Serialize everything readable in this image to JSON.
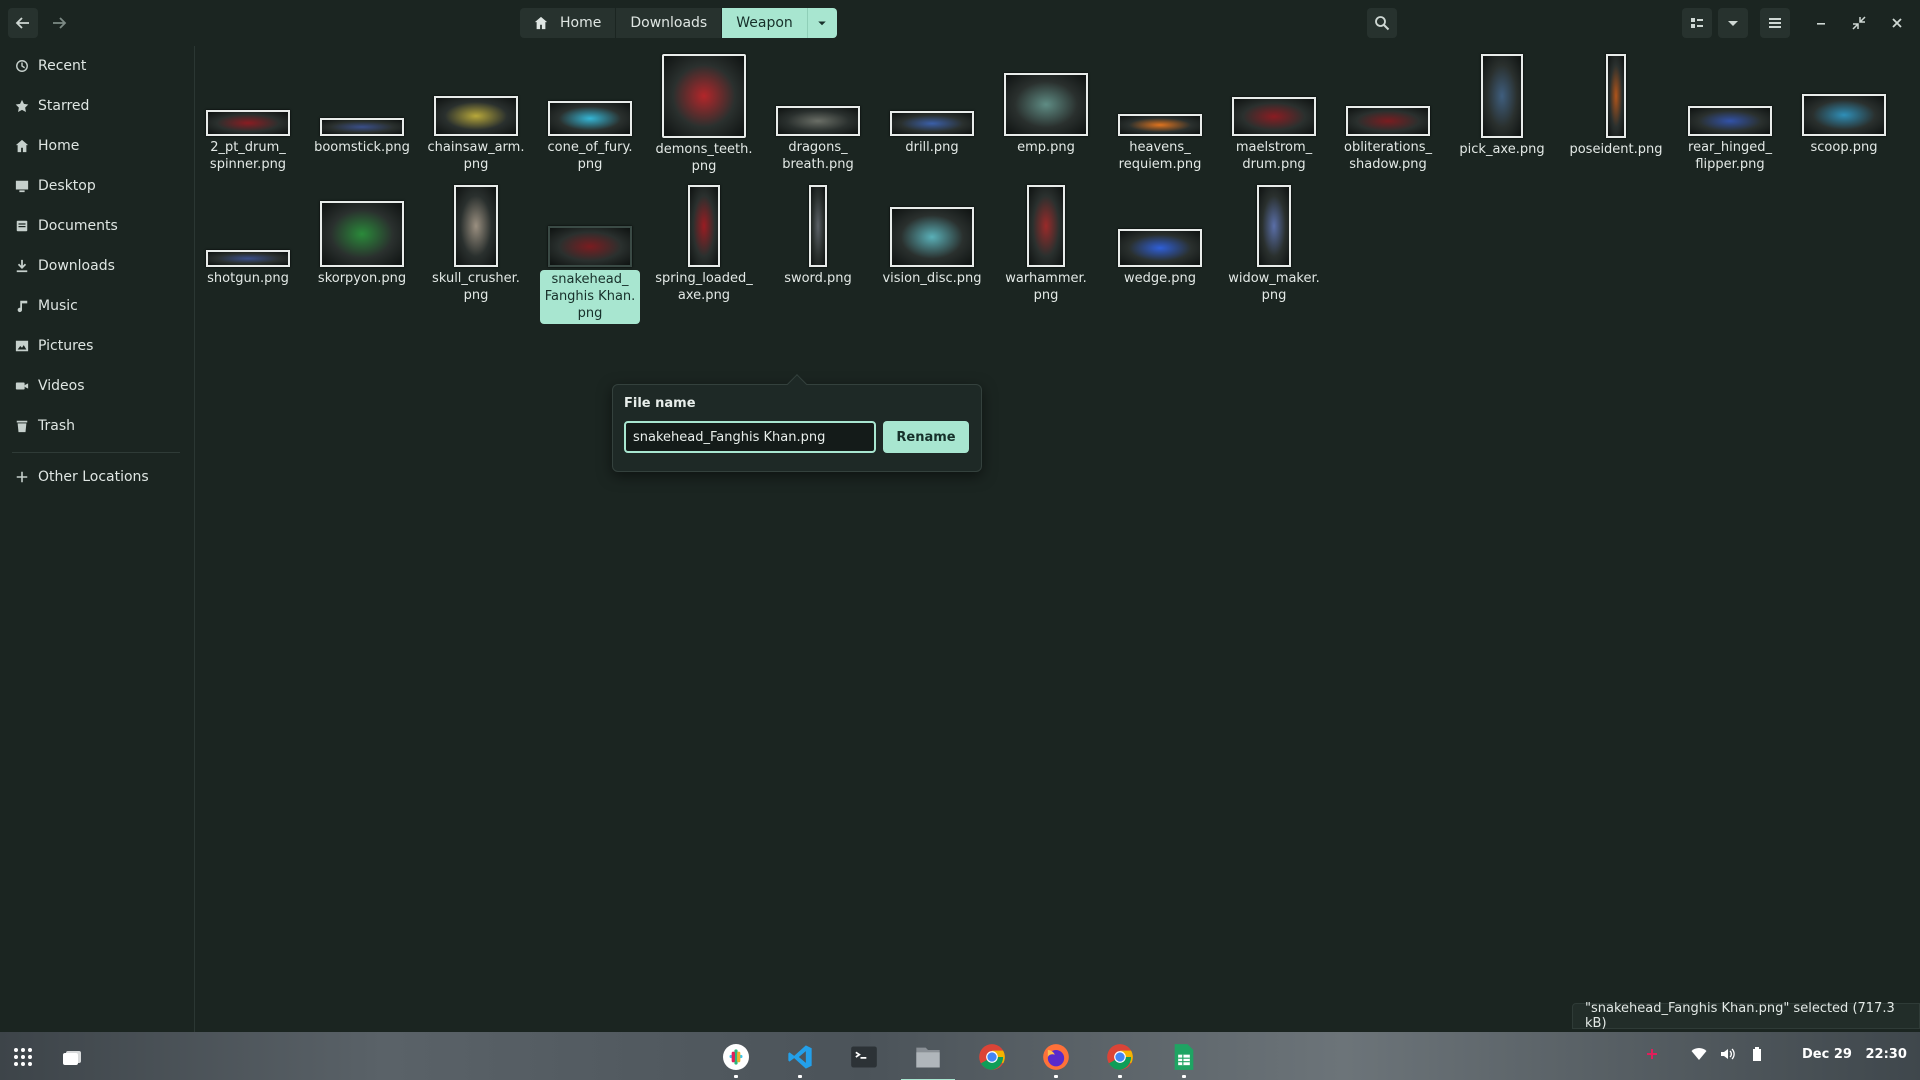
{
  "header": {
    "path": [
      {
        "label": "Home",
        "icon": "home-icon"
      },
      {
        "label": "Downloads"
      },
      {
        "label": "Weapon",
        "active": true
      }
    ]
  },
  "sidebar": {
    "items": [
      {
        "label": "Recent",
        "icon": "clock-icon"
      },
      {
        "label": "Starred",
        "icon": "star-icon"
      },
      {
        "label": "Home",
        "icon": "home-icon"
      },
      {
        "label": "Desktop",
        "icon": "desktop-icon"
      },
      {
        "label": "Documents",
        "icon": "document-icon"
      },
      {
        "label": "Downloads",
        "icon": "download-icon"
      },
      {
        "label": "Music",
        "icon": "music-icon"
      },
      {
        "label": "Pictures",
        "icon": "picture-icon"
      },
      {
        "label": "Videos",
        "icon": "video-icon"
      },
      {
        "label": "Trash",
        "icon": "trash-icon"
      }
    ],
    "other": {
      "label": "Other Locations",
      "icon": "plus-icon"
    }
  },
  "files": [
    {
      "name": "2_pt_drum_ spinner.png",
      "color": "#8a1c22"
    },
    {
      "name": "boomstick.png",
      "color": "#3a4f8a"
    },
    {
      "name": "chainsaw_arm. png",
      "color": "#b8a83a"
    },
    {
      "name": "cone_of_fury. png",
      "color": "#35b6d6"
    },
    {
      "name": "demons_teeth. png",
      "color": "#b3262a"
    },
    {
      "name": "dragons_ breath.png",
      "color": "#6a6e66"
    },
    {
      "name": "drill.png",
      "color": "#3b5fa8"
    },
    {
      "name": "emp.png",
      "color": "#5f8c84"
    },
    {
      "name": "heavens_ requiem.png",
      "color": "#e0741f"
    },
    {
      "name": "maelstrom_ drum.png",
      "color": "#8a1c22"
    },
    {
      "name": "obliterations_ shadow.png",
      "color": "#7a1c20"
    },
    {
      "name": "pick_axe.png",
      "color": "#3f5e7e"
    },
    {
      "name": "poseident.png",
      "color": "#b0541a"
    },
    {
      "name": "rear_hinged_ flipper.png",
      "color": "#3252a8"
    },
    {
      "name": "scoop.png",
      "color": "#2f8fb8"
    },
    {
      "name": "shotgun.png",
      "color": "#3a4f8a"
    },
    {
      "name": "skorpyon.png",
      "color": "#2a8a3a"
    },
    {
      "name": "skull_crusher. png",
      "color": "#9a8f80"
    },
    {
      "name": "snakehead_ Fanghis Khan. png",
      "color": "#7a1c20"
    },
    {
      "name": "spring_loaded_ axe.png",
      "color": "#9a1c22"
    },
    {
      "name": "sword.png",
      "color": "#5a6066"
    },
    {
      "name": "vision_disc.png",
      "color": "#5ab0b8"
    },
    {
      "name": "warhammer. png",
      "color": "#9a2a2a"
    },
    {
      "name": "wedge.png",
      "color": "#2f5fd8"
    },
    {
      "name": "widow_maker. png",
      "color": "#5a6fa8"
    }
  ],
  "rename": {
    "label": "File name",
    "value": "snakehead_Fanghis Khan.png",
    "button": "Rename"
  },
  "status": "\"snakehead_Fanghis Khan.png\" selected  (717.3 kB)",
  "taskbar": {
    "apps": [
      "slack-icon",
      "vscode-icon",
      "terminal-icon",
      "files-icon",
      "chrome-icon",
      "firefox-icon",
      "chrome-icon",
      "spreadsheet-icon"
    ],
    "date": "Dec 29",
    "time": "22:30"
  },
  "colors": {
    "accent": "#a8e6d0",
    "background": "#1b2521"
  }
}
